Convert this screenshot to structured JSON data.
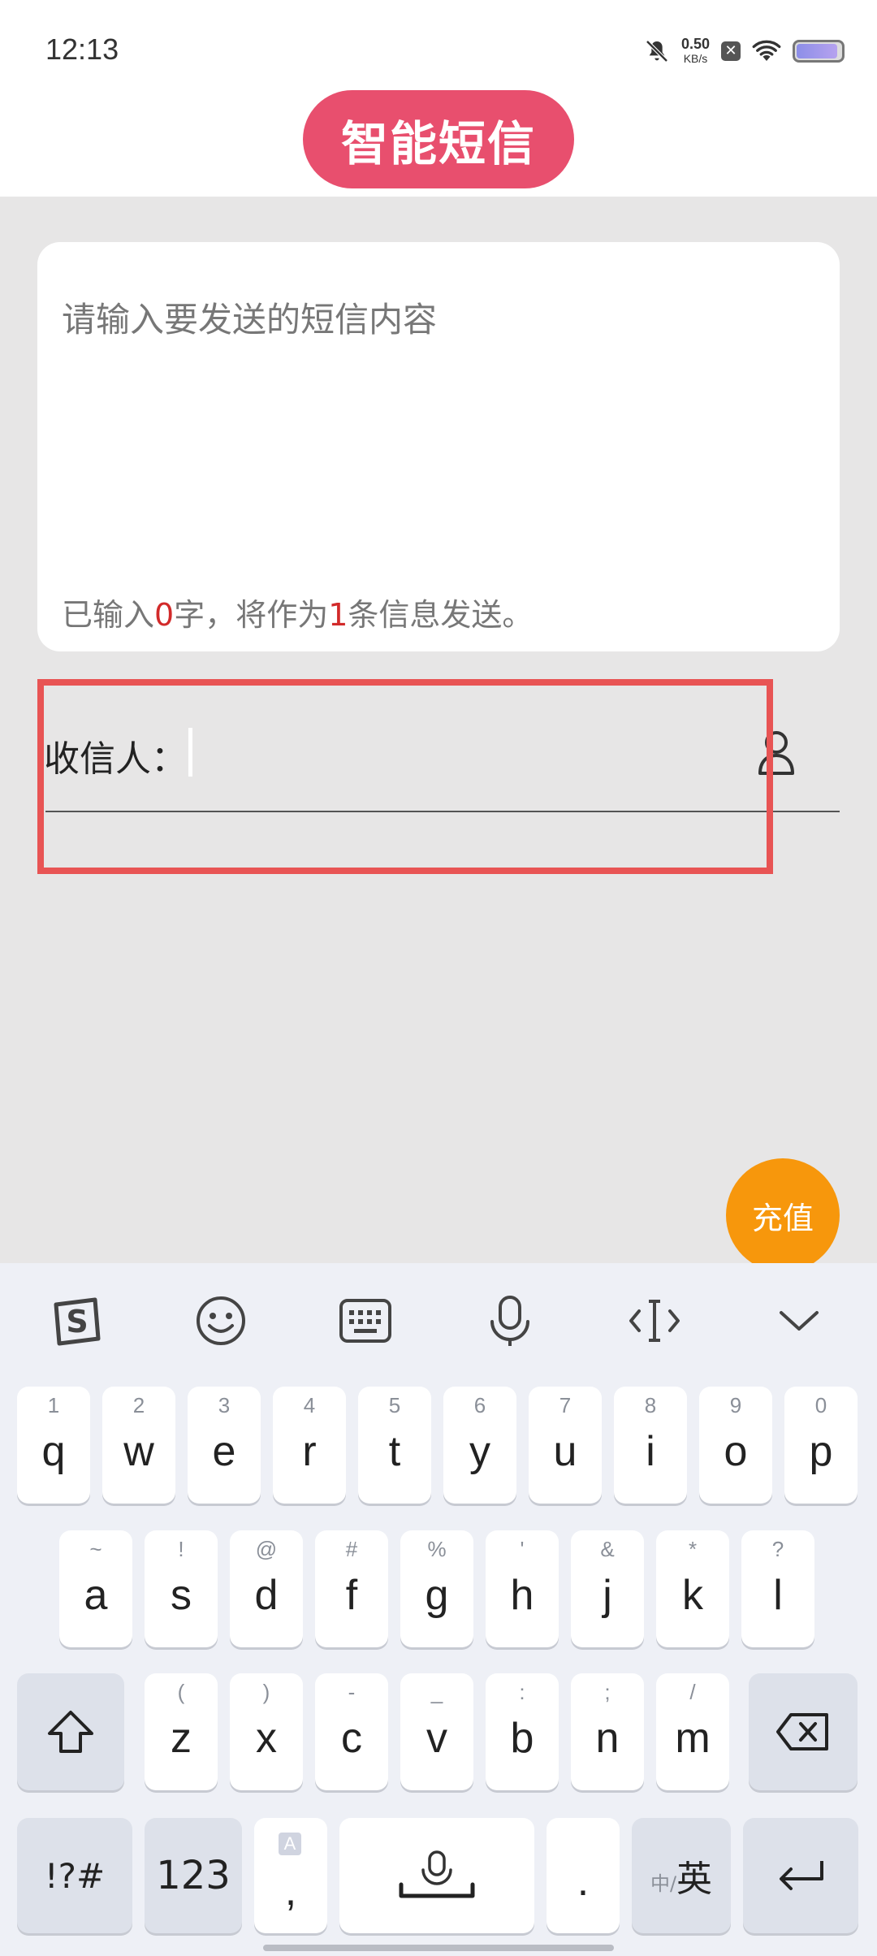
{
  "status_bar": {
    "time": "12:13",
    "net_speed_value": "0.50",
    "net_speed_unit": "KB/s",
    "icons": [
      "bell-off-icon",
      "sim-disabled-icon",
      "wifi-icon",
      "battery-icon"
    ]
  },
  "header": {
    "title": "智能短信"
  },
  "message": {
    "placeholder": "请输入要发送的短信内容",
    "counter_prefix": "已输入",
    "char_count": "0",
    "counter_middle": "字，将作为",
    "msg_count": "1",
    "counter_suffix": "条信息发送。"
  },
  "recipient": {
    "label": "收信人：",
    "value": ""
  },
  "recharge_label": "充值",
  "colors": {
    "title_bg": "#e84f6e",
    "recharge_bg": "#f7970c",
    "highlight": "#e85454",
    "counter_red": "#d22a2a"
  },
  "keyboard": {
    "toolbar": [
      "sogou-logo-icon",
      "emoji-icon",
      "keyboard-icon",
      "microphone-icon",
      "cursor-move-icon",
      "collapse-keyboard-icon"
    ],
    "row1": [
      {
        "hint": "1",
        "key": "q"
      },
      {
        "hint": "2",
        "key": "w"
      },
      {
        "hint": "3",
        "key": "e"
      },
      {
        "hint": "4",
        "key": "r"
      },
      {
        "hint": "5",
        "key": "t"
      },
      {
        "hint": "6",
        "key": "y"
      },
      {
        "hint": "7",
        "key": "u"
      },
      {
        "hint": "8",
        "key": "i"
      },
      {
        "hint": "9",
        "key": "o"
      },
      {
        "hint": "0",
        "key": "p"
      }
    ],
    "row2": [
      {
        "hint": "~",
        "key": "a"
      },
      {
        "hint": "!",
        "key": "s"
      },
      {
        "hint": "@",
        "key": "d"
      },
      {
        "hint": "#",
        "key": "f"
      },
      {
        "hint": "%",
        "key": "g"
      },
      {
        "hint": "'",
        "key": "h"
      },
      {
        "hint": "&",
        "key": "j"
      },
      {
        "hint": "*",
        "key": "k"
      },
      {
        "hint": "?",
        "key": "l"
      }
    ],
    "row3": [
      {
        "hint": "(",
        "key": "z"
      },
      {
        "hint": ")",
        "key": "x"
      },
      {
        "hint": "-",
        "key": "c"
      },
      {
        "hint": "_",
        "key": "v"
      },
      {
        "hint": ":",
        "key": "b"
      },
      {
        "hint": ";",
        "key": "n"
      },
      {
        "hint": "/",
        "key": "m"
      }
    ],
    "symbols_label": "!?#",
    "numbers_label": "123",
    "comma_hint": "A",
    "comma_label": ",",
    "period_label": ".",
    "lang_small": "中/",
    "lang_label": "英"
  }
}
